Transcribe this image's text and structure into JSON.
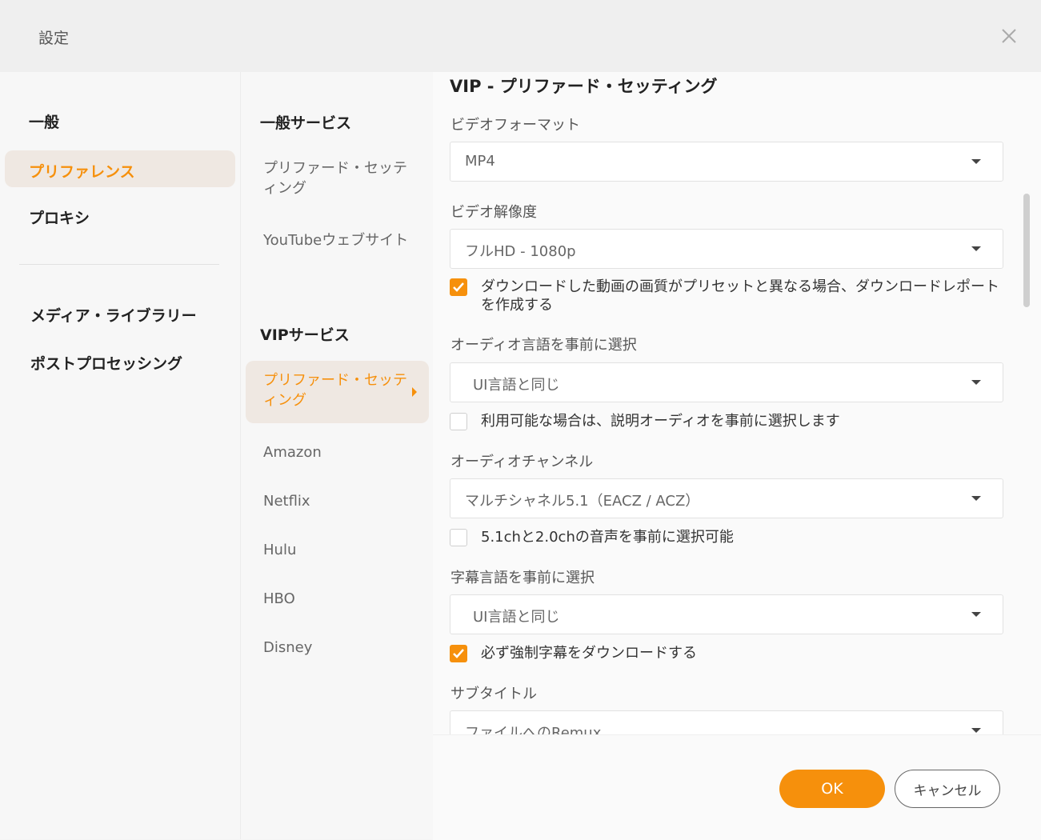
{
  "window": {
    "title": "設定"
  },
  "nav_primary": {
    "items": [
      "一般",
      "プリファレンス",
      "プロキシ",
      "メディア・ライブラリー",
      "ポストプロセッシング"
    ],
    "active": "プリファレンス"
  },
  "nav_secondary": {
    "general_heading": "一般サービス",
    "general_items": [
      "プリファード・セッティング",
      "YouTubeウェブサイト"
    ],
    "vip_heading": "VIPサービス",
    "vip_active": "プリファード・セッティング",
    "vip_items": [
      "Amazon",
      "Netflix",
      "Hulu",
      "HBO",
      "Disney"
    ]
  },
  "settings": {
    "heading": "VIP - プリファード・セッティング",
    "video_format": {
      "label": "ビデオフォーマット",
      "value": "MP4"
    },
    "video_resolution": {
      "label": "ビデオ解像度",
      "value": "フルHD - 1080p"
    },
    "download_report": {
      "text": "ダウンロードした動画の画質がプリセットと異なる場合、ダウンロードレポートを作成する",
      "checked": true
    },
    "audio_language": {
      "label": "オーディオ言語を事前に選択",
      "value": "UI言語と同じ"
    },
    "audio_description": {
      "text": "利用可能な場合は、説明オーディオを事前に選択します",
      "checked": false
    },
    "audio_channel": {
      "label": "オーディオチャンネル",
      "value": "マルチシャネル5.1（EACZ / ACZ）"
    },
    "channel_both": {
      "text": "5.1chと2.0chの音声を事前に選択可能",
      "checked": false
    },
    "subtitle_language": {
      "label": "字幕言語を事前に選択",
      "value": "UI言語と同じ"
    },
    "forced_subtitles": {
      "text": "必ず強制字幕をダウンロードする",
      "checked": true
    },
    "subtitle": {
      "label": "サブタイトル",
      "value": "ファイルへのRemux"
    }
  },
  "footer": {
    "ok_label": "OK",
    "cancel_label": "キャンセル"
  },
  "colors": {
    "accent": "#f6900c",
    "active_bg": "#efe8e2"
  }
}
